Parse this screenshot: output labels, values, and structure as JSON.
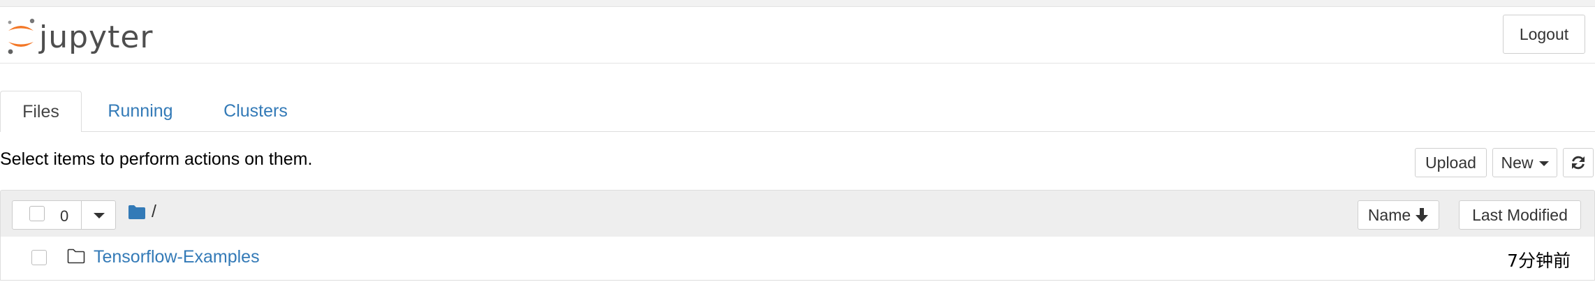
{
  "header": {
    "logo_text": "jupyter",
    "logout_label": "Logout"
  },
  "tabs": [
    {
      "label": "Files",
      "active": true
    },
    {
      "label": "Running",
      "active": false
    },
    {
      "label": "Clusters",
      "active": false
    }
  ],
  "toolbar": {
    "instruction": "Select items to perform actions on them.",
    "upload_label": "Upload",
    "new_label": "New",
    "refresh_icon": "refresh-icon"
  },
  "list_header": {
    "selected_count": "0",
    "path": "/",
    "name_sort_label": "Name",
    "last_modified_label": "Last Modified"
  },
  "files": [
    {
      "name": "Tensorflow-Examples",
      "modified": "7分钟前",
      "type": "folder"
    }
  ],
  "colors": {
    "link": "#337ab7",
    "jupyter_orange": "#f37726",
    "header_bg": "#eeeeee"
  }
}
